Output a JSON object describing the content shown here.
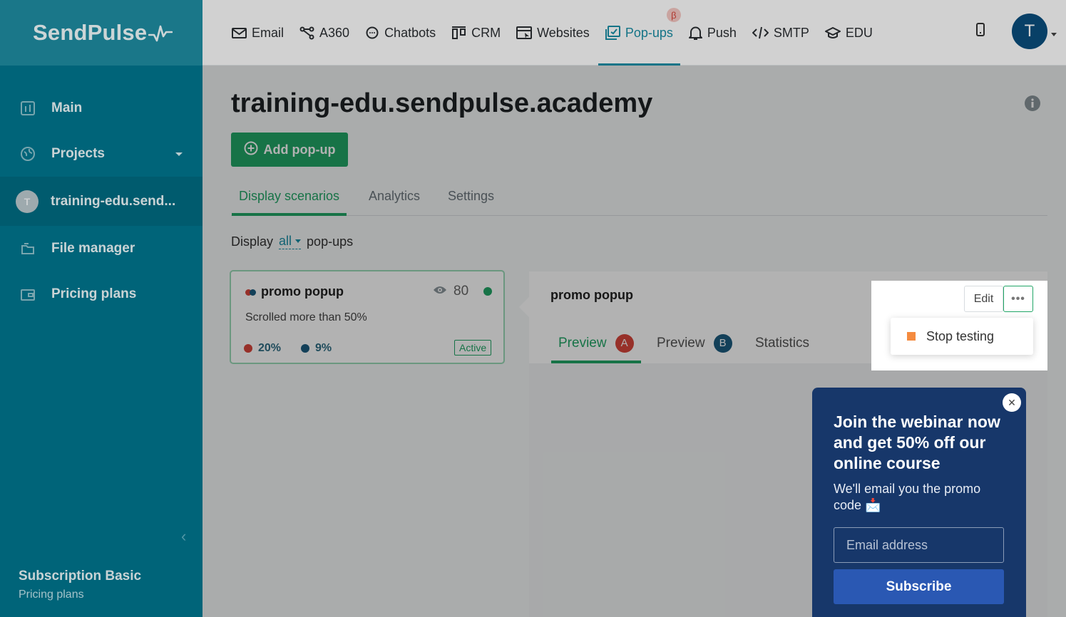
{
  "sidebar": {
    "logo": "SendPulse",
    "items": [
      {
        "label": "Main",
        "icon": "dashboard-icon"
      },
      {
        "label": "Projects",
        "icon": "globe-icon"
      },
      {
        "label": "training-edu.send...",
        "avatar": "T"
      },
      {
        "label": "File manager",
        "icon": "folder-icon"
      },
      {
        "label": "Pricing plans",
        "icon": "wallet-icon"
      }
    ],
    "subscription_title": "Subscription Basic",
    "subscription_link": "Pricing plans"
  },
  "topnav": {
    "items": [
      {
        "label": "Email",
        "icon": "envelope-icon"
      },
      {
        "label": "A360",
        "icon": "automation-icon"
      },
      {
        "label": "Chatbots",
        "icon": "chat-icon"
      },
      {
        "label": "CRM",
        "icon": "crm-icon"
      },
      {
        "label": "Websites",
        "icon": "website-icon"
      },
      {
        "label": "Pop-ups",
        "icon": "popup-icon",
        "badge": "β"
      },
      {
        "label": "Push",
        "icon": "bell-icon"
      },
      {
        "label": "SMTP",
        "icon": "code-icon"
      },
      {
        "label": "EDU",
        "icon": "graduation-cap-icon"
      }
    ],
    "user_initial": "T"
  },
  "page": {
    "title": "training-edu.sendpulse.academy",
    "add_button": "Add pop-up",
    "tabs": [
      "Display scenarios",
      "Analytics",
      "Settings"
    ],
    "display_prefix": "Display",
    "display_filter": "all",
    "display_suffix": "pop-ups"
  },
  "card": {
    "title": "promo popup",
    "views": "80",
    "condition": "Scrolled more than 50%",
    "stat_a": "20%",
    "stat_b": "9%",
    "status": "Active"
  },
  "detail": {
    "title": "promo popup",
    "edit_label": "Edit",
    "more_label": "•••",
    "tabs": [
      {
        "label": "Preview",
        "badge": "A"
      },
      {
        "label": "Preview",
        "badge": "B"
      },
      {
        "label": "Statistics"
      }
    ],
    "menu_item": "Stop testing"
  },
  "widget": {
    "close": "✕",
    "heading": "Join the webinar now and get 50% off our online course",
    "subtext": "We'll email you the promo code 📩",
    "email_placeholder": "Email address",
    "button": "Subscribe"
  },
  "colors": {
    "sidebar": "#00758d",
    "accent_green": "#21a566",
    "accent_teal": "#1a8ea5",
    "variant_a": "#d9463b",
    "variant_b": "#1c5c80",
    "widget_bg": "#17376a",
    "subscribe_btn": "#2a58b3",
    "stop_square": "#f58b3f"
  }
}
